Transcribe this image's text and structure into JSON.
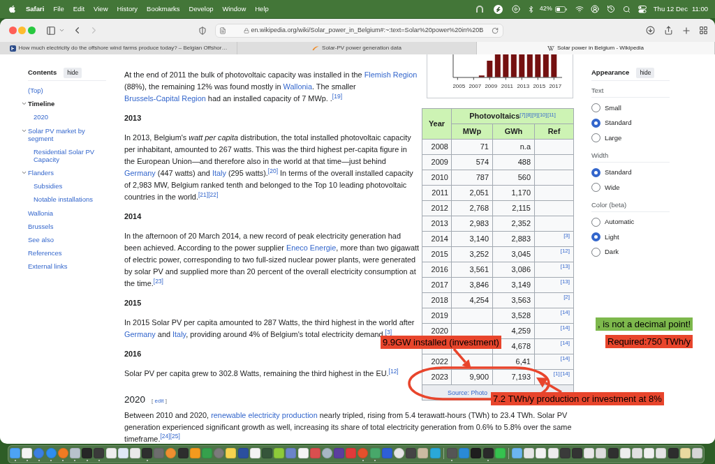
{
  "menu_bar": {
    "app": "Safari",
    "menus": [
      "File",
      "Edit",
      "View",
      "History",
      "Bookmarks",
      "Develop",
      "Window",
      "Help"
    ],
    "battery": "42%",
    "date": "Thu 12 Dec",
    "time": "11:00"
  },
  "toolbar": {
    "url": "en.wikipedia.org/wiki/Solar_power_in_Belgium#:~:text=Solar%20power%20in%20B",
    "back_disabled": false,
    "forward_disabled": true
  },
  "tabs": [
    {
      "title": "How much electricity do the offshore wind farms produce today? – Belgian Offshor…",
      "selected": false
    },
    {
      "title": "Solar-PV power generation data",
      "selected": false
    },
    {
      "title": "Solar power in Belgium - Wikipedia",
      "selected": true
    }
  ],
  "contents": {
    "title": "Contents",
    "hide": "hide",
    "items": [
      {
        "label": "(Top)",
        "selected": false
      },
      {
        "label": "Timeline",
        "selected": true,
        "expanded": true,
        "children": [
          {
            "label": "2020",
            "selected": false
          }
        ]
      },
      {
        "label": "Solar PV market by segment",
        "selected": false,
        "expanded": true,
        "children": [
          {
            "label": "Residential Solar PV Capacity",
            "selected": false
          }
        ]
      },
      {
        "label": "Flanders",
        "selected": false,
        "expanded": true,
        "children": [
          {
            "label": "Subsidies",
            "selected": false
          },
          {
            "label": "Notable installations",
            "selected": false
          }
        ]
      },
      {
        "label": "Wallonia",
        "selected": false
      },
      {
        "label": "Brussels",
        "selected": false
      },
      {
        "label": "See also",
        "selected": false
      },
      {
        "label": "References",
        "selected": false
      },
      {
        "label": "External links",
        "selected": false
      }
    ]
  },
  "figure": {
    "x_labels": [
      "2005",
      "2007",
      "2009",
      "2011",
      "2013",
      "2015",
      "2017"
    ]
  },
  "table": {
    "year_header": "Year",
    "group_header": "Photovoltaics",
    "group_refs": [
      "[7]",
      "[8]",
      "[9]",
      "[10]",
      "[11]"
    ],
    "sub_headers": [
      "MWp",
      "GWh",
      "Ref"
    ],
    "rows": [
      {
        "year": "2008",
        "mwp": "71",
        "gwh": "n.a"
      },
      {
        "year": "2009",
        "mwp": "574",
        "gwh": "488"
      },
      {
        "year": "2010",
        "mwp": "787",
        "gwh": "560"
      },
      {
        "year": "2011",
        "mwp": "2,051",
        "gwh": "1,170"
      },
      {
        "year": "2012",
        "mwp": "2,768",
        "gwh": "2,115"
      },
      {
        "year": "2013",
        "mwp": "2,983",
        "gwh": "2,352"
      },
      {
        "year": "2014",
        "mwp": "3,140",
        "gwh": "2,883",
        "refs": [
          "[3]"
        ]
      },
      {
        "year": "2015",
        "mwp": "3,252",
        "gwh": "3,045",
        "refs": [
          "[12]"
        ]
      },
      {
        "year": "2016",
        "mwp": "3,561",
        "gwh": "3,086",
        "refs": [
          "[13]"
        ]
      },
      {
        "year": "2017",
        "mwp": "3,846",
        "gwh": "3,149",
        "refs": [
          "[13]"
        ]
      },
      {
        "year": "2018",
        "mwp": "4,254",
        "gwh": "3,563",
        "refs": [
          "[2]"
        ]
      },
      {
        "year": "2019",
        "gwh": "3,528",
        "refs": [
          "[14]"
        ]
      },
      {
        "year": "2020",
        "gwh": "4,259",
        "refs": [
          "[14]"
        ]
      },
      {
        "gwh": "4,678",
        "refs": [
          "[14]"
        ]
      },
      {
        "year": "2022",
        "gwh": "6,41",
        "refs": [
          "[14]"
        ]
      },
      {
        "year": "2023",
        "mwp": "9,900",
        "gwh": "7,193",
        "refs": [
          "[1]",
          "[14]"
        ]
      }
    ],
    "footer": "Source: Photo"
  },
  "article": {
    "blocks": [
      {
        "kind": "paragraph",
        "segments": [
          {
            "kind": "text",
            "text": "At the end of 2011 the bulk of photovoltaic capacity was installed in the "
          },
          {
            "kind": "link",
            "text": "Flemish Region"
          },
          {
            "kind": "text",
            "text": " (88%), the remaining 12% was found mostly in "
          },
          {
            "kind": "link",
            "text": "Wallonia"
          },
          {
            "kind": "text",
            "text": ". The smaller "
          },
          {
            "kind": "link",
            "text": "Brussels-Capital Region"
          },
          {
            "kind": "text",
            "text": " had an installed capacity of 7 MWp. ."
          },
          {
            "kind": "cite",
            "text": "[19]"
          }
        ]
      },
      {
        "kind": "subheading",
        "text": "2013"
      },
      {
        "kind": "paragraph",
        "segments": [
          {
            "kind": "text",
            "text": "In 2013, Belgium's *watt per capita* distribution, the total installed photovoltaic capacity per inhabitant, amounted to 267 watts. This was the third highest per-capita figure in the European Union—and therefore also in the world at that time—just behind "
          },
          {
            "kind": "link",
            "text": "Germany"
          },
          {
            "kind": "text",
            "text": " (447 watts) and "
          },
          {
            "kind": "link",
            "text": "Italy"
          },
          {
            "kind": "text",
            "text": " (295 watts)."
          },
          {
            "kind": "cite",
            "text": "[20]"
          },
          {
            "kind": "text",
            "text": " In terms of the overall installed capacity of 2,983 MW, Belgium ranked tenth and belonged to the Top 10 leading photovoltaic countries in the world."
          },
          {
            "kind": "cite",
            "text": "[21]"
          },
          {
            "kind": "cite",
            "text": "[22]"
          }
        ]
      },
      {
        "kind": "subheading",
        "text": "2014"
      },
      {
        "kind": "paragraph",
        "segments": [
          {
            "kind": "text",
            "text": "In the afternoon of 20 March 2014, a new record of peak electricity generation had been achieved. According to the power supplier "
          },
          {
            "kind": "link",
            "text": "Eneco Energie"
          },
          {
            "kind": "text",
            "text": ", more than two gigawatt of electric power, corresponding to two full-sized nuclear power plants, were generated by solar PV and supplied more than 20 percent of the overall electricity consumption at the time."
          },
          {
            "kind": "cite",
            "text": "[23]"
          }
        ]
      },
      {
        "kind": "subheading",
        "text": "2015"
      },
      {
        "kind": "paragraph",
        "segments": [
          {
            "kind": "text",
            "text": "In 2015 Solar PV per capita amounted to 287 Watts, the third highest in the world after "
          },
          {
            "kind": "link",
            "text": "Germany"
          },
          {
            "kind": "text",
            "text": " and "
          },
          {
            "kind": "link",
            "text": "Italy"
          },
          {
            "kind": "text",
            "text": ", providing around 4% of Belgium's total electricity demand."
          },
          {
            "kind": "cite",
            "text": "[3]"
          }
        ]
      },
      {
        "kind": "subheading",
        "text": "2016"
      },
      {
        "kind": "paragraph",
        "segments": [
          {
            "kind": "text",
            "text": "Solar PV per capita grew to 302.8 Watts, remaining the third highest in the EU."
          },
          {
            "kind": "cite",
            "text": "[12]"
          }
        ]
      },
      {
        "kind": "heading",
        "text": "2020",
        "edit_open": "[",
        "edit": "edit",
        "edit_close": "]"
      },
      {
        "kind": "paragraph",
        "segments": [
          {
            "kind": "text",
            "text": "Between 2010 and 2020, "
          },
          {
            "kind": "link",
            "text": "renewable electricity production"
          },
          {
            "kind": "text",
            "text": " nearly tripled, rising from 5.4 terawatt-hours (TWh) to 23.4 TWh. Solar PV generation experienced significant growth as well, increasing its share of total electricity generation from 0.6% to 5.8% over the same timeframe."
          },
          {
            "kind": "cite",
            "text": "[24]"
          },
          {
            "kind": "cite",
            "text": "[25]"
          }
        ]
      }
    ]
  },
  "appearance": {
    "title": "Appearance",
    "hide": "hide",
    "groups": [
      {
        "label": "Text",
        "options": [
          {
            "label": "Small",
            "selected": false
          },
          {
            "label": "Standard",
            "selected": true
          },
          {
            "label": "Large",
            "selected": false
          }
        ]
      },
      {
        "label": "Width",
        "options": [
          {
            "label": "Standard",
            "selected": true
          },
          {
            "label": "Wide",
            "selected": false
          }
        ]
      },
      {
        "label": "Color (beta)",
        "options": [
          {
            "label": "Automatic",
            "selected": false
          },
          {
            "label": "Light",
            "selected": true
          },
          {
            "label": "Dark",
            "selected": false
          }
        ]
      }
    ]
  },
  "annotations": [
    {
      "text": ", is not a decimal point!",
      "color": "#7db84c"
    },
    {
      "text": "9.9GW installed (investment)",
      "color": "#e8452c"
    },
    {
      "text": "Required:750 TWh/y",
      "color": "#e8452c"
    },
    {
      "text": "7.2 TWh/y production or investment at 8%",
      "color": "#e8452c"
    }
  ],
  "dock": {
    "items": [
      {
        "running": true
      },
      {
        "running": true
      },
      {
        "running": true
      },
      {
        "running": true
      },
      {
        "running": true
      },
      {
        "running": true
      },
      {
        "running": true
      },
      {
        "running": true
      },
      {
        "running": false
      },
      {
        "running": false
      },
      {
        "running": false
      },
      {
        "running": true
      },
      {
        "running": false
      },
      {
        "running": false
      },
      {
        "running": false
      },
      {
        "running": false
      },
      {
        "running": false
      },
      {
        "running": false
      },
      {
        "running": false
      },
      {
        "running": false
      },
      {
        "running": false
      },
      {
        "running": false
      },
      {
        "running": false
      },
      {
        "running": false
      },
      {
        "running": false
      },
      {
        "running": false
      },
      {
        "running": false
      },
      {
        "running": false
      },
      {
        "running": false
      },
      {
        "running": true
      },
      {
        "running": true
      },
      {
        "running": false
      },
      {
        "running": false
      },
      {
        "running": false
      },
      {
        "running": false
      },
      {
        "running": false
      },
      {
        "running": true
      },
      {
        "running": false
      },
      {
        "running": false
      },
      {
        "running": true
      },
      {
        "running": false
      },
      {
        "running": false
      },
      {
        "running": false
      },
      {
        "running": false
      },
      {
        "running": false
      },
      {
        "running": false
      },
      {
        "running": false
      },
      {
        "running": false
      },
      {
        "running": false
      },
      {
        "running": false
      },
      {
        "running": false
      },
      {
        "running": false
      },
      {
        "running": false
      },
      {
        "running": false
      },
      {
        "running": false
      },
      {
        "running": false
      },
      {
        "running": false
      }
    ]
  }
}
